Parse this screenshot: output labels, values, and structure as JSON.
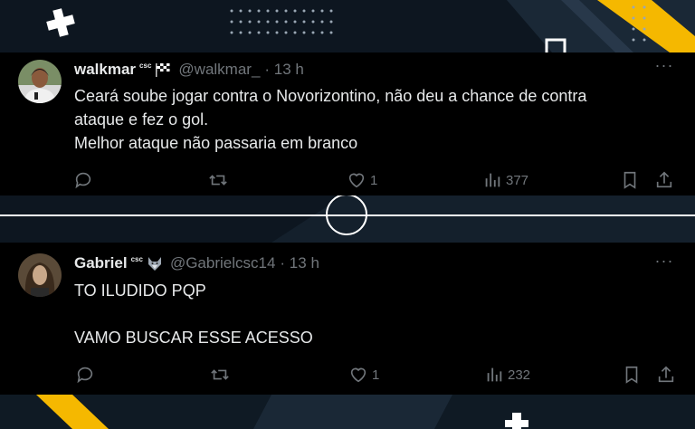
{
  "tweets": [
    {
      "name": "walkmar",
      "badge": "csc",
      "emoji": "checkered-flag",
      "handle": "@walkmar_",
      "time": "· 13 h",
      "text": "Ceará soube jogar contra o Novorizontino, não deu a chance de contra\nataque e fez o gol.\nMelhor ataque não passaria em branco",
      "likes": "1",
      "views": "377"
    },
    {
      "name": "Gabriel",
      "badge": "csc",
      "emoji": "wolf-face",
      "handle": "@Gabrielcsc14",
      "time": "· 13 h",
      "text": "TO ILUDIDO PQP\n\nVAMO BUSCAR ESSE ACESSO",
      "likes": "1",
      "views": "232"
    }
  ],
  "more_label": "···",
  "colors": {
    "background": "#0d1620",
    "tweet_bg": "#000000",
    "muted": "#71767b",
    "accent": "#f5b800"
  }
}
